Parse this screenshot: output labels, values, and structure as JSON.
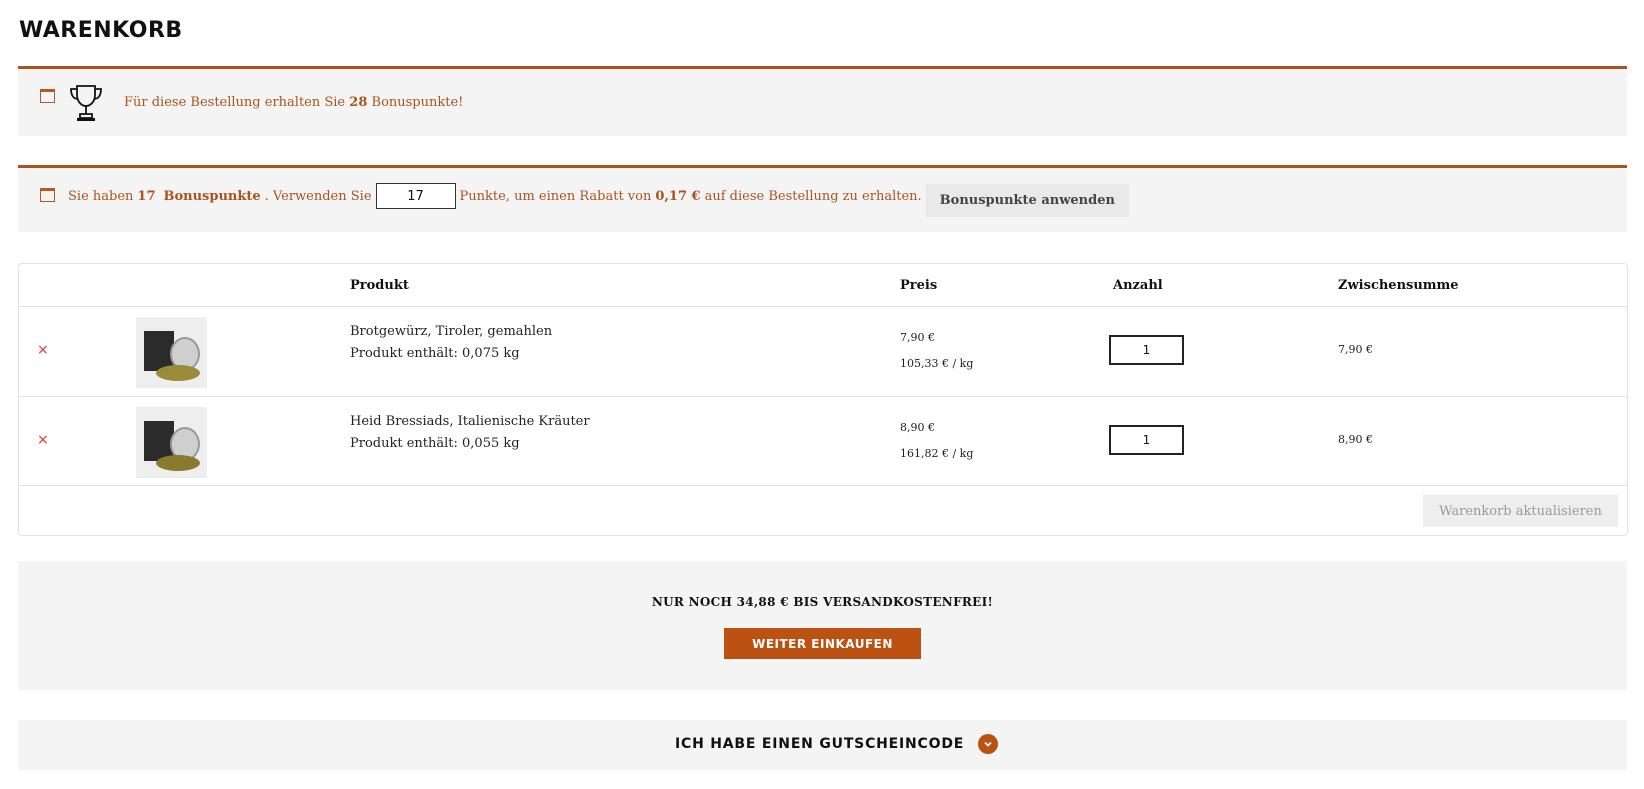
{
  "page": {
    "title": "WARENKORB"
  },
  "bonus_earn_notice": {
    "text_before": "Für diese Bestellung erhalten Sie",
    "points": "28",
    "text_after": "Bonuspunkte!"
  },
  "bonus_redeem_notice": {
    "text_1": "Sie haben",
    "points_available": "17",
    "points_word": "Bonuspunkte",
    "text_2": ". Verwenden Sie",
    "points_input_value": "17",
    "text_3": "Punkte, um einen Rabatt von",
    "discount": "0,17 €",
    "text_4": "auf diese Bestellung zu erhalten.",
    "apply_button_label": "Bonuspunkte anwenden"
  },
  "cart_table": {
    "headers": {
      "product": "Produkt",
      "price": "Preis",
      "quantity": "Anzahl",
      "subtotal": "Zwischensumme"
    },
    "rows": [
      {
        "remove": "×",
        "name": "Brotgewürz, Tiroler, gemahlen",
        "content": "Produkt enthält: 0,075 kg",
        "price": "7,90 €",
        "unit_price": "105,33 € / kg",
        "quantity": "1",
        "subtotal": "7,90 €"
      },
      {
        "remove": "×",
        "name": "Heid Bressiads, Italienische Kräuter",
        "content": "Produkt enthält: 0,055 kg",
        "price": "8,90 €",
        "unit_price": "161,82 € / kg",
        "quantity": "1",
        "subtotal": "8,90 €"
      }
    ],
    "update_button_label": "Warenkorb aktualisieren"
  },
  "shipping": {
    "text": "NUR NOCH 34,88 € BIS VERSANDKOSTENFREI!",
    "continue_button_label": "WEITER EINKAUFEN"
  },
  "coupon": {
    "text": "ICH HABE EINEN GUTSCHEINCODE"
  },
  "colors": {
    "accent": "#bb5212",
    "notice_text": "#a8541e",
    "remove": "#dd3333",
    "panel_bg": "#f4f4f4"
  },
  "icons": [
    "notice-icon",
    "trophy-icon",
    "remove-icon",
    "chevron-down-icon"
  ]
}
